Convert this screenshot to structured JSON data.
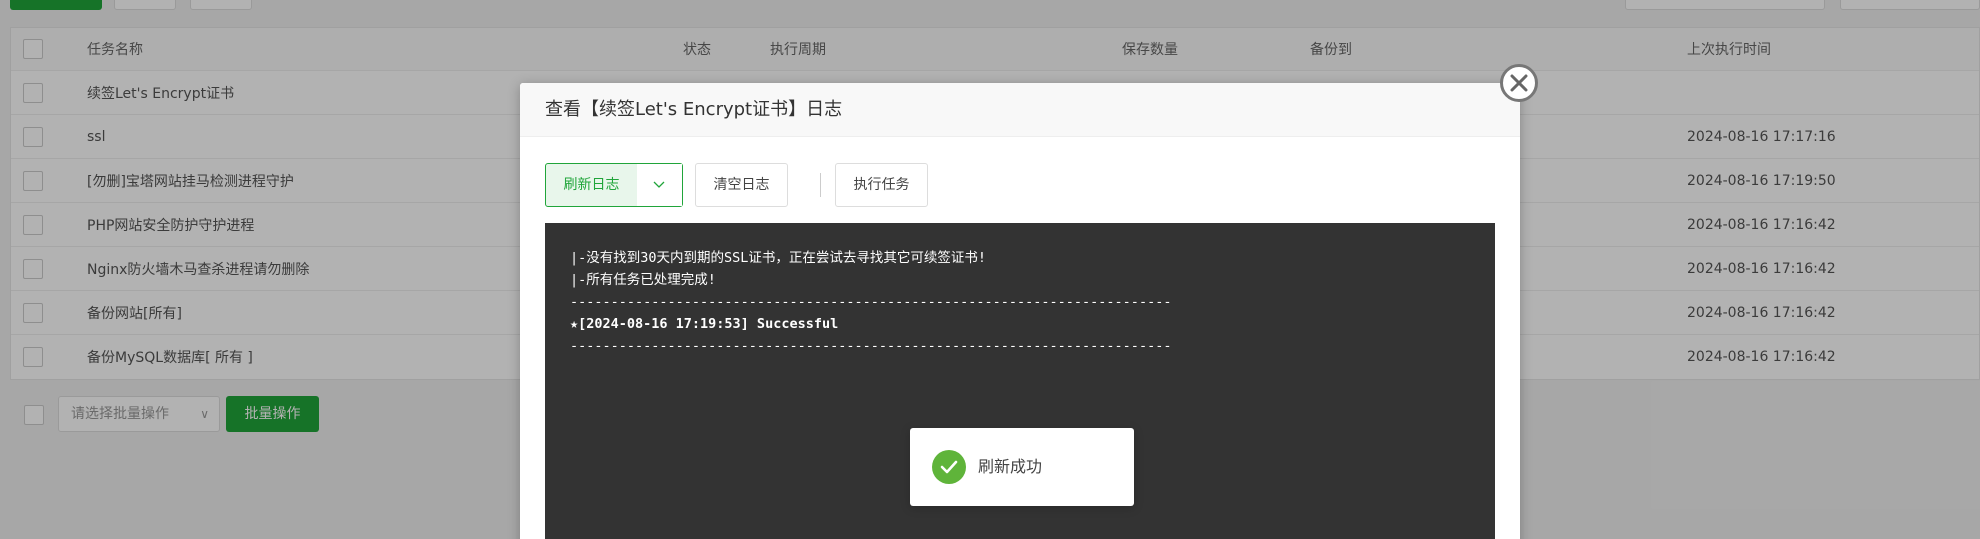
{
  "table": {
    "headers": {
      "name": "任务名称",
      "status": "状态",
      "cycle": "执行周期",
      "keep": "保存数量",
      "backup_to": "备份到",
      "last_run": "上次执行时间"
    },
    "rows": [
      {
        "name": "续签Let's Encrypt证书",
        "last_run": ""
      },
      {
        "name": "ssl",
        "last_run": "2024-08-16 17:17:16"
      },
      {
        "name": "[勿删]宝塔网站挂马检测进程守护",
        "last_run": "2024-08-16 17:19:50"
      },
      {
        "name": "PHP网站安全防护守护进程",
        "last_run": "2024-08-16 17:16:42"
      },
      {
        "name": "Nginx防火墙木马查杀进程请勿删除",
        "last_run": "2024-08-16 17:16:42"
      },
      {
        "name": "备份网站[所有]",
        "last_run": "2024-08-16 17:16:42"
      },
      {
        "name": "备份MySQL数据库[ 所有 ]",
        "last_run": "2024-08-16 17:16:42"
      }
    ]
  },
  "bulk": {
    "select_placeholder": "请选择批量操作",
    "button": "批量操作"
  },
  "modal": {
    "title": "查看【续签Let's Encrypt证书】日志",
    "buttons": {
      "refresh": "刷新日志",
      "clear": "清空日志",
      "run": "执行任务"
    },
    "log_lines": [
      "|-没有找到30天内到期的SSL证书，正在尝试去寻找其它可续签证书!",
      "|-所有任务已处理完成!",
      "--------------------------------------------------------------------------",
      "★[2024-08-16 17:19:53] Successful",
      "--------------------------------------------------------------------------"
    ]
  },
  "toast": {
    "message": "刷新成功"
  },
  "colors": {
    "accent": "#20a53a",
    "console_bg": "#333333",
    "success": "#5fb43a"
  }
}
